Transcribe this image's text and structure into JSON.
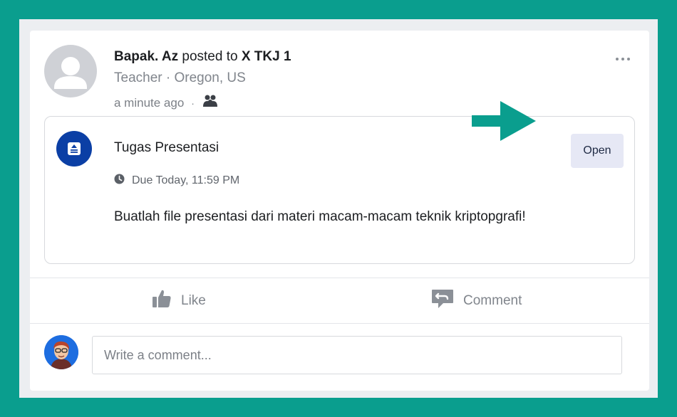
{
  "post": {
    "author": "Bapak. Az",
    "posted_to_text": "posted to",
    "group": "X TKJ 1",
    "role_location": "Teacher · Oregon, US",
    "time": "a minute ago",
    "separator": "·",
    "audience_icon": "group-icon",
    "more_icon": "more-horizontal-icon"
  },
  "assignment": {
    "icon": "assignment-icon",
    "title": "Tugas Presentasi",
    "due": "Due Today, 11:59 PM",
    "description": "Buatlah file presentasi dari materi macam-macam teknik kriptopgrafi!",
    "open_label": "Open"
  },
  "annotation": {
    "arrow_color": "#0a9e8e"
  },
  "actions": {
    "like_label": "Like",
    "comment_label": "Comment"
  },
  "comment_box": {
    "placeholder": "Write a comment..."
  },
  "colors": {
    "background": "#0a9e8e",
    "assignment_icon_bg": "#0b3fa5",
    "open_button_bg": "#e6e8f5"
  }
}
